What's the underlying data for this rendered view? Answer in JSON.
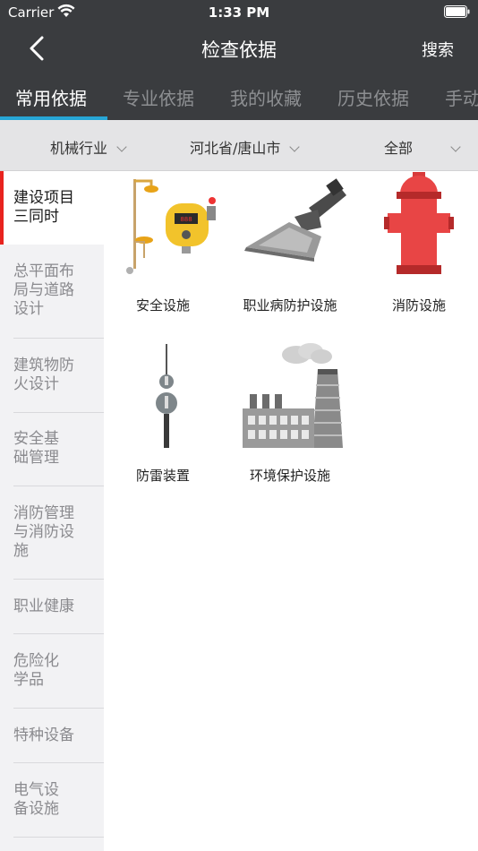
{
  "status_bar": {
    "carrier": "Carrier",
    "time": "1:33 PM"
  },
  "nav": {
    "title": "检查依据",
    "search_label": "搜索"
  },
  "tabs": [
    {
      "label": "常用依据",
      "active": true
    },
    {
      "label": "专业依据",
      "active": false
    },
    {
      "label": "我的收藏",
      "active": false
    },
    {
      "label": "历史依据",
      "active": false
    },
    {
      "label": "手动",
      "active": false
    }
  ],
  "filters": [
    {
      "label": "机械行业"
    },
    {
      "label": "河北省/唐山市"
    },
    {
      "label": "全部"
    }
  ],
  "sidebar": {
    "items": [
      {
        "line1": "建设项目",
        "line2": "三同时",
        "line3": "",
        "active": true
      },
      {
        "line1": "总平面布",
        "line2": "局与道路",
        "line3": "设计",
        "active": false
      },
      {
        "line1": "建筑物防",
        "line2": "火设计",
        "line3": "",
        "active": false
      },
      {
        "line1": "安全基",
        "line2": "础管理",
        "line3": "",
        "active": false
      },
      {
        "line1": "消防管理",
        "line2": "与消防设",
        "line3": "施",
        "active": false
      },
      {
        "line1": "职业健康",
        "line2": "",
        "line3": "",
        "active": false
      },
      {
        "line1": "危险化",
        "line2": "学品",
        "line3": "",
        "active": false
      },
      {
        "line1": "特种设备",
        "line2": "",
        "line3": "",
        "active": false
      },
      {
        "line1": "电气设",
        "line2": "备设施",
        "line3": "",
        "active": false
      }
    ]
  },
  "grid": [
    {
      "label": "安全设施",
      "icon": "safety-facility-icon"
    },
    {
      "label": "职业病防护设施",
      "icon": "occupational-protection-icon"
    },
    {
      "label": "消防设施",
      "icon": "fire-hydrant-icon"
    },
    {
      "label": "防雷装置",
      "icon": "lightning-rod-icon"
    },
    {
      "label": "环境保护设施",
      "icon": "factory-icon"
    }
  ],
  "colors": {
    "header_bg": "#3a3c3f",
    "tab_indicator": "#27a6d6",
    "sidebar_active_bar": "#e8231e"
  }
}
